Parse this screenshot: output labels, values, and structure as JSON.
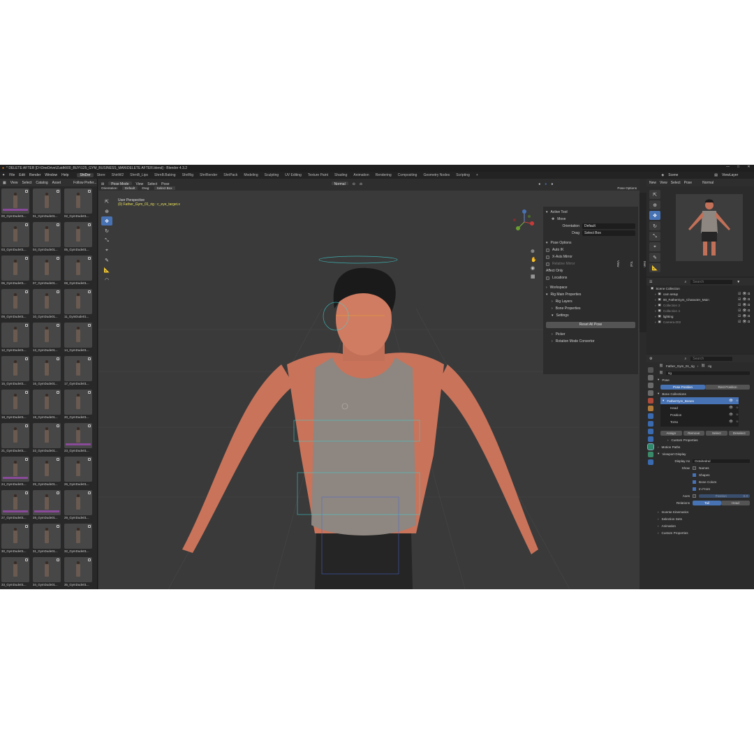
{
  "titlebar": {
    "title": "* DELETE AFTER [D:\\OneDrive\\Zuidhl\\00_BUY\\125_GYM_BUSINESS_MAN\\DELETE AFTER.blend] - Blender 4.3.2",
    "min": "—",
    "max": "□",
    "close": "✕"
  },
  "menubar": {
    "menus": [
      "File",
      "Edit",
      "Render",
      "Window",
      "Help"
    ],
    "workspaces": [
      "ShiDer",
      "Store",
      "ShiriW2",
      "ShrnB_Lips",
      "ShrnB.Baking",
      "ShriRig",
      "ShriRender",
      "ShriPack",
      "Modeling",
      "Sculpting",
      "UV Editing",
      "Texture Paint",
      "Shading",
      "Animation",
      "Rendering",
      "Compositing",
      "Geometry Nodes",
      "Scripting",
      "+"
    ],
    "active_workspace": "ShiDer",
    "scene_label": "Scene",
    "viewlayer_label": "ViewLayer"
  },
  "asset_browser": {
    "menus": [
      "View",
      "Select",
      "Catalog",
      "Asset"
    ],
    "follow_prefs": "Follow Prefer...",
    "items": [
      {
        "label": "00_GymDude01...",
        "pink": true
      },
      {
        "label": "01_GymDude01...",
        "pink": false
      },
      {
        "label": "02_GymDude01...",
        "pink": false
      },
      {
        "label": "03_GymDude01...",
        "pink": false
      },
      {
        "label": "04_GymDude01...",
        "pink": false
      },
      {
        "label": "05_GymDude01...",
        "pink": false
      },
      {
        "label": "06_GymDude01...",
        "pink": false
      },
      {
        "label": "07_GymDude01...",
        "pink": false
      },
      {
        "label": "08_GymDude01...",
        "pink": false
      },
      {
        "label": "09_GymDude01...",
        "pink": false
      },
      {
        "label": "10_GymDude01...",
        "pink": false
      },
      {
        "label": "11_GymDude01...",
        "pink": false
      },
      {
        "label": "12_GymDude01...",
        "pink": false
      },
      {
        "label": "13_GymDude01...",
        "pink": false
      },
      {
        "label": "14_GymDude01...",
        "pink": false
      },
      {
        "label": "15_GymDude01...",
        "pink": false
      },
      {
        "label": "16_GymDude01...",
        "pink": false
      },
      {
        "label": "17_GymDude01...",
        "pink": false
      },
      {
        "label": "18_GymDude01...",
        "pink": false
      },
      {
        "label": "19_GymDude01...",
        "pink": false
      },
      {
        "label": "20_GymDude01...",
        "pink": false
      },
      {
        "label": "21_GymDude01...",
        "pink": false
      },
      {
        "label": "22_GymDude01...",
        "pink": false
      },
      {
        "label": "23_GymDude01...",
        "pink": true
      },
      {
        "label": "24_GymDude01...",
        "pink": true
      },
      {
        "label": "25_GymDude01...",
        "pink": false
      },
      {
        "label": "26_GymDude01...",
        "pink": false
      },
      {
        "label": "27_GymDude01...",
        "pink": true
      },
      {
        "label": "28_GymDude01...",
        "pink": true
      },
      {
        "label": "29_GymDude01...",
        "pink": false
      },
      {
        "label": "30_GymDude01...",
        "pink": false
      },
      {
        "label": "31_GymDude01...",
        "pink": false
      },
      {
        "label": "32_GymDude01...",
        "pink": false
      },
      {
        "label": "33_GymDude01...",
        "pink": false
      },
      {
        "label": "34_GymDude01...",
        "pink": false
      },
      {
        "label": "35_GymDude01...",
        "pink": false
      }
    ]
  },
  "viewport": {
    "mode": "Pose Mode",
    "menus": [
      "View",
      "Select",
      "Pose"
    ],
    "orientation_label": "Orientation:",
    "orientation_value": "Default",
    "drag_label": "Drag:",
    "drag_value": "Select Box",
    "shading": "Normal",
    "pose_options": "Pose Options",
    "perspective": "User Perspective",
    "active_object": "(0) Father_Gym_01_rig : c_eye_target.x"
  },
  "npanel": {
    "tabs": [
      "Item",
      "Tool",
      "View"
    ],
    "active_tool_title": "Active Tool",
    "active_tool": "Move",
    "orientation_label": "Orientation",
    "orientation_value": "Default",
    "drag_label": "Drag",
    "drag_value": "Select Box",
    "pose_options_title": "Pose Options",
    "auto_ik": "Auto IK",
    "x_axis_mirror": "X-Axis Mirror",
    "relative_mirror": "Relative Mirror",
    "affect_only": "Affect Only",
    "locations": "Locations",
    "workspace": "Workspace",
    "rig_main_props": "Rig Main Properties",
    "rig_layers": "Rig Layers",
    "bone_properties": "Bone Properties",
    "settings": "Settings",
    "reset_all_pose": "Reset All Pose",
    "picker": "Picker",
    "rotation_mode_convertor": "Rotation Mode Convertor"
  },
  "right": {
    "menus": [
      "View",
      "Select",
      "Pose"
    ],
    "shading": "Normal",
    "new_label": "New"
  },
  "outliner": {
    "search_placeholder": "Search",
    "root": "Scene Collection",
    "rows": [
      {
        "name": "cam setup",
        "dim": false
      },
      {
        "name": "00_FatherGym_Character_Main",
        "dim": false
      },
      {
        "name": "Collection 3",
        "dim": true
      },
      {
        "name": "Collection 4",
        "dim": true
      },
      {
        "name": "lighting",
        "dim": false
      },
      {
        "name": "Camera.002",
        "dim": true
      }
    ]
  },
  "properties": {
    "search_placeholder": "Search",
    "object_name": "Father_Gym_01_rig",
    "data_name": "rig",
    "datablock": "rig",
    "pose_title": "Pose",
    "pose_position": "Pose Position",
    "rest_position": "Rest Position",
    "bone_collections_title": "Bone Collections",
    "collections": [
      "FatherGym_Bones",
      "Head",
      "Position",
      "Torso"
    ],
    "assign": "Assign",
    "remove": "Remove",
    "select": "Select",
    "deselect": "Deselect",
    "custom_props_1": "Custom Properties",
    "motion_paths": "Motion Paths",
    "viewport_display": "Viewport Display",
    "display_as_label": "Display As",
    "display_as_value": "Octahedral",
    "show_label": "Show",
    "names": "Names",
    "shapes": "Shapes",
    "bone_colors": "Bone Colors",
    "in_front": "In Front",
    "axes_label": "Axes",
    "axes_position": "Position",
    "axes_value": "0.0",
    "relations_label": "Relations",
    "tail": "Tail",
    "head": "Head",
    "inverse_kinematics": "Inverse Kinematics",
    "selection_sets": "Selection Sets",
    "animation": "Animation",
    "custom_props_2": "Custom Properties"
  },
  "colors": {
    "accent": "#4772b3",
    "pose_text": "#e8e058",
    "rig_cyan": "#3fd4d4"
  }
}
